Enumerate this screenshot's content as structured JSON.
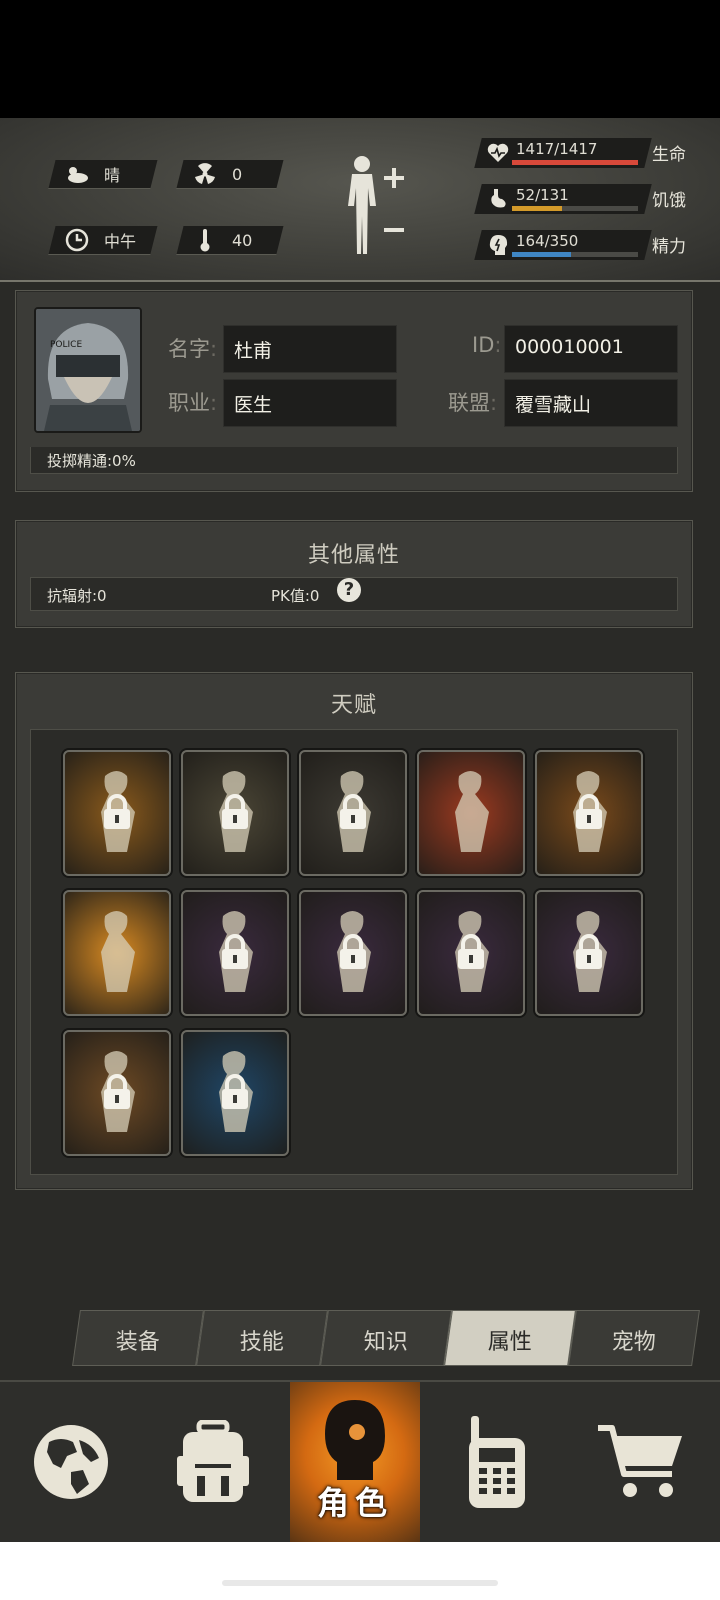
{
  "hud": {
    "weather": "晴",
    "radiation": "0",
    "time": "中午",
    "temperature": "40",
    "stats": [
      {
        "label": "生命",
        "value": "1417/1417",
        "fill": 1.0,
        "color": "#d8493a",
        "icon": "heart-icon"
      },
      {
        "label": "饥饿",
        "value": "52/131",
        "fill": 0.397,
        "color": "#d39a2a",
        "icon": "stomach-icon"
      },
      {
        "label": "精力",
        "value": "164/350",
        "fill": 0.469,
        "color": "#3f86c4",
        "icon": "energy-head-icon"
      }
    ]
  },
  "profile": {
    "name_label": "名字",
    "name": "杜甫",
    "id_label": "ID",
    "id": "000010001",
    "job_label": "职业",
    "job": "医生",
    "alliance_label": "联盟",
    "alliance": "覆雪藏山",
    "throw_mastery": "投掷精通:0%"
  },
  "other_attrs": {
    "title": "其他属性",
    "radiation_resist": "抗辐射:0",
    "pk_value": "PK值:0"
  },
  "talents": {
    "title": "天赋",
    "items": [
      {
        "name": "talent-porter",
        "bg": "#8a5a1c",
        "locked": true
      },
      {
        "name": "talent-panda",
        "bg": "#4b4636",
        "locked": true
      },
      {
        "name": "talent-brute",
        "bg": "#3d3a33",
        "locked": true
      },
      {
        "name": "talent-fist",
        "bg": "#9c3a20",
        "locked": false
      },
      {
        "name": "talent-muscle",
        "bg": "#7a4a1a",
        "locked": true
      },
      {
        "name": "talent-boxer",
        "bg": "#d88a22",
        "locked": false
      },
      {
        "name": "talent-pistol",
        "bg": "#3a2a3e",
        "locked": true
      },
      {
        "name": "talent-rifle",
        "bg": "#3a2a3e",
        "locked": true
      },
      {
        "name": "talent-archer",
        "bg": "#3a2a3e",
        "locked": true
      },
      {
        "name": "talent-shield",
        "bg": "#3a2a3e",
        "locked": true
      },
      {
        "name": "talent-kick",
        "bg": "#6e4a24",
        "locked": true
      },
      {
        "name": "talent-crouch",
        "bg": "#1f4666",
        "locked": true
      }
    ]
  },
  "tabs": [
    "装备",
    "技能",
    "知识",
    "属性",
    "宠物"
  ],
  "active_tab": "属性",
  "nav": {
    "active_label": "角色"
  }
}
